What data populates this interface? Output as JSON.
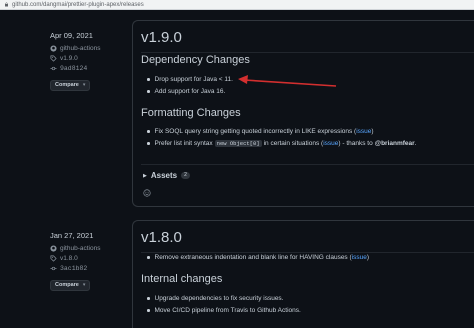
{
  "browser": {
    "url": "github.com/dangmai/prettier-plugin-apex/releases"
  },
  "releases": [
    {
      "date": "Apr 09, 2021",
      "author": "github-actions",
      "tag": "v1.9.0",
      "commit": "9ad8124",
      "compare_label": "Compare",
      "version": "v1.9.0",
      "sections": [
        {
          "title": "Dependency Changes"
        },
        {
          "title": "Formatting Changes"
        }
      ],
      "items": {
        "drop_java": "Drop support for Java < 11.",
        "add_java": "Add support for Java 16.",
        "fix_soql": "Fix SOQL query string getting quoted incorrectly in LIKE expressions (",
        "issue": "issue",
        "close_paren": ")",
        "prefer_pre": "Prefer list init syntax",
        "code": "new Object[0]",
        "prefer_mid": "in certain situations (",
        "prefer_post": ") - thanks to",
        "thanks_user": "@brianmfear",
        "period": "."
      },
      "assets_label": "Assets",
      "assets_count": "2"
    },
    {
      "date": "Jan 27, 2021",
      "author": "github-actions",
      "tag": "v1.8.0",
      "commit": "3ac1b82",
      "compare_label": "Compare",
      "version": "v1.8.0",
      "items": {
        "remove_indent": "Remove extraneous indentation and blank line for HAVING clauses (",
        "issue": "issue",
        "close_paren": ")",
        "upgrade_deps": "Upgrade dependencies to fix security issues.",
        "move_ci": "Move CI/CD pipeline from Travis to Github Actions."
      },
      "internal_title": "Internal changes"
    }
  ],
  "colors": {
    "background": "#0d1117",
    "link": "#58a6ff",
    "annotation_arrow": "#d32f2f"
  }
}
